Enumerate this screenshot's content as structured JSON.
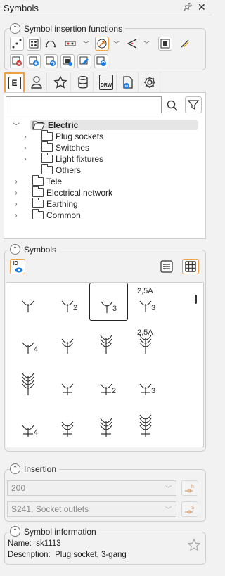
{
  "window": {
    "title": "Symbols",
    "pin_icon": "pin-icon",
    "close_icon": "close-icon"
  },
  "insertion_functions": {
    "title": "Symbol insertion functions",
    "tools": [
      "connect-points-icon",
      "grid-points-icon",
      "arc-icon",
      "multi-insert-icon",
      "rotate-arrow-icon",
      "angle-insert-icon",
      "fit-frame-icon",
      "offset-icon",
      "delete-symbol-icon",
      "add-symbol-icon",
      "replace-symbol-icon",
      "copy-symbol-icon",
      "edit-symbol-icon",
      "refresh-symbol-icon"
    ]
  },
  "tabs": [
    {
      "id": "electric",
      "label": "E",
      "active": true
    },
    {
      "id": "user",
      "icon": "user-icon"
    },
    {
      "id": "favorites",
      "icon": "star-icon"
    },
    {
      "id": "database",
      "icon": "database-icon"
    },
    {
      "id": "drw",
      "label": "DRW"
    },
    {
      "id": "document",
      "icon": "document-icon"
    },
    {
      "id": "settings",
      "icon": "gear-icon"
    }
  ],
  "search": {
    "value": "",
    "placeholder": ""
  },
  "tree": [
    {
      "label": "Electric",
      "level": 1,
      "expanded": true,
      "selected": true
    },
    {
      "label": "Plug sockets",
      "level": 2
    },
    {
      "label": "Switches",
      "level": 2
    },
    {
      "label": "Light fixtures",
      "level": 2
    },
    {
      "label": "Others",
      "level": 2
    },
    {
      "label": "Tele",
      "level": 1
    },
    {
      "label": "Electrical network",
      "level": 1
    },
    {
      "label": "Earthing",
      "level": 1
    },
    {
      "label": "Common",
      "level": 1
    }
  ],
  "symbols": {
    "title": "Symbols",
    "id_button": "ID",
    "view_list_icon": "list-view-icon",
    "view_grid_icon": "grid-view-icon",
    "cells": [
      {
        "prongs": 1,
        "suffix": "",
        "top": ""
      },
      {
        "prongs": 1,
        "suffix": "2",
        "top": ""
      },
      {
        "prongs": 1,
        "suffix": "3",
        "top": "",
        "selected": true
      },
      {
        "prongs": 1,
        "suffix": "3",
        "top": "2,5A"
      },
      {
        "prongs": 1,
        "suffix": "4",
        "top": ""
      },
      {
        "prongs": 2,
        "suffix": "",
        "top": ""
      },
      {
        "prongs": 3,
        "suffix": "",
        "top": ""
      },
      {
        "prongs": 3,
        "suffix": "",
        "top": "2,5A"
      },
      {
        "prongs": 4,
        "suffix": "",
        "top": ""
      },
      {
        "prongs": 1,
        "suffix": "",
        "top": "",
        "bar": true
      },
      {
        "prongs": 1,
        "suffix": "2",
        "top": "",
        "bar": true
      },
      {
        "prongs": 1,
        "suffix": "3",
        "top": "",
        "bar": true
      },
      {
        "prongs": 1,
        "suffix": "4",
        "top": "",
        "bar": true
      },
      {
        "prongs": 2,
        "suffix": "",
        "top": "",
        "bar": true
      },
      {
        "prongs": 3,
        "suffix": "",
        "top": "",
        "bar": true
      },
      {
        "prongs": 4,
        "suffix": "",
        "top": "",
        "bar": true
      }
    ]
  },
  "insertion": {
    "title": "Insertion",
    "height_value": "200",
    "layer_value": "S241, Socket outlets",
    "height_button_icon": "height-icon",
    "layer_button_icon": "layer-icon"
  },
  "symbol_info": {
    "title": "Symbol information",
    "name_label": "Name:",
    "name_value": "sk1113",
    "description_label": "Description:",
    "description_value": "Plug socket, 3-gang",
    "favorite_icon": "star-outline-icon"
  }
}
